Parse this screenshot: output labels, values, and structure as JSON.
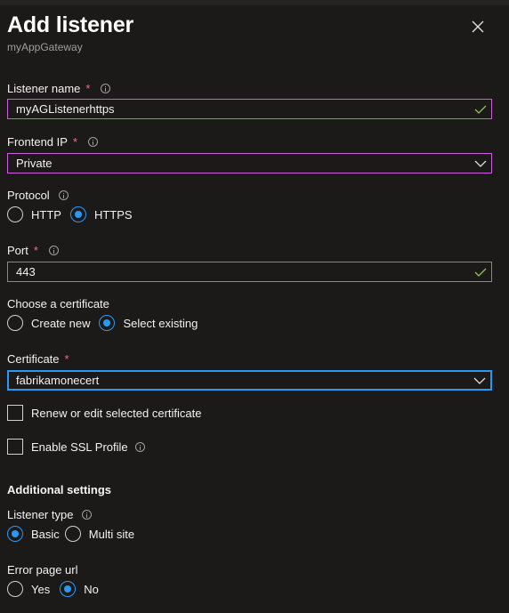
{
  "header": {
    "title": "Add listener",
    "subtitle": "myAppGateway"
  },
  "fields": {
    "listener_name": {
      "label": "Listener name",
      "required": "*",
      "value": "myAGListenerhttps",
      "state": "valid"
    },
    "frontend_ip": {
      "label": "Frontend IP",
      "required": "*",
      "value": "Private"
    },
    "protocol": {
      "label": "Protocol",
      "options": [
        "HTTP",
        "HTTPS"
      ],
      "selected": "HTTPS"
    },
    "port": {
      "label": "Port",
      "required": "*",
      "value": "443",
      "state": "valid"
    },
    "choose_certificate": {
      "label": "Choose a certificate",
      "options": [
        "Create new",
        "Select existing"
      ],
      "selected": "Select existing"
    },
    "certificate": {
      "label": "Certificate",
      "required": "*",
      "value": "fabrikamonecert"
    },
    "renew_checkbox": {
      "label": "Renew or edit selected certificate",
      "checked": false
    },
    "ssl_profile_checkbox": {
      "label": "Enable SSL Profile",
      "checked": false
    }
  },
  "additional": {
    "heading": "Additional settings",
    "listener_type": {
      "label": "Listener type",
      "options": [
        "Basic",
        "Multi site"
      ],
      "selected": "Basic"
    },
    "error_page_url": {
      "label": "Error page url",
      "options": [
        "Yes",
        "No"
      ],
      "selected": "No"
    }
  },
  "icons": {
    "close": "close-icon",
    "info": "info-icon",
    "check": "checkmark-icon",
    "chevron": "chevron-down-icon"
  },
  "colors": {
    "background": "#1b1a19",
    "accent": "#2899f5",
    "focus_purple": "#c85fd6",
    "valid_green": "#92c353",
    "required_red": "#f1707b"
  }
}
